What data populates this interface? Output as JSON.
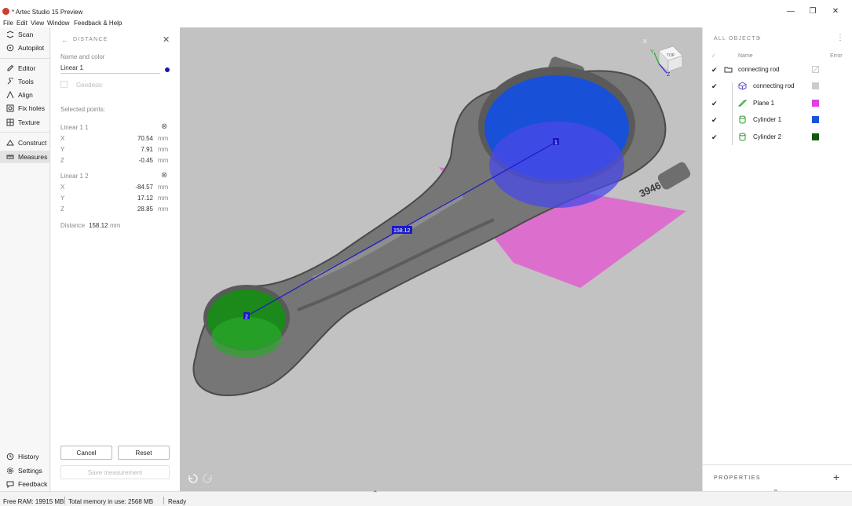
{
  "window": {
    "title": "* Artec Studio 15 Preview",
    "minimize_glyph": "—",
    "restore_glyph": "❐",
    "close_glyph": "✕"
  },
  "menu": [
    "File",
    "Edit",
    "View",
    "Window",
    "Feedback & Help"
  ],
  "sidebar": {
    "items": [
      {
        "label": "Scan",
        "icon": "scan-icon"
      },
      {
        "label": "Autopilot",
        "icon": "autopilot-icon"
      },
      {
        "label": "Editor",
        "icon": "pencil-icon"
      },
      {
        "label": "Tools",
        "icon": "wrench-icon"
      },
      {
        "label": "Align",
        "icon": "align-icon"
      },
      {
        "label": "Fix holes",
        "icon": "fix-holes-icon"
      },
      {
        "label": "Texture",
        "icon": "texture-icon"
      },
      {
        "label": "Construct",
        "icon": "construct-icon"
      },
      {
        "label": "Measures",
        "icon": "ruler-icon"
      }
    ],
    "active_label": "Measures",
    "bottom_items": [
      {
        "label": "History",
        "icon": "history-icon"
      },
      {
        "label": "Settings",
        "icon": "gear-icon"
      },
      {
        "label": "Feedback",
        "icon": "feedback-icon"
      }
    ]
  },
  "panel": {
    "header": "DISTANCE",
    "name_color_label": "Name and color",
    "name_value": "Linear 1",
    "name_color": "#1a1aa8",
    "geodesic_label": "Geodesic",
    "selected_points_label": "Selected points:",
    "points": [
      {
        "title": "Linear 1 1",
        "x": "70.54",
        "y": "7.91",
        "z": "-0.45"
      },
      {
        "title": "Linear 1 2",
        "x": "-84.57",
        "y": "17.12",
        "z": "28.85"
      }
    ],
    "axis_x": "X",
    "axis_y": "Y",
    "axis_z": "Z",
    "unit": "mm",
    "distance_label": "Distance",
    "distance_value": "158.12",
    "cancel_label": "Cancel",
    "reset_label": "Reset",
    "save_label": "Save measurement"
  },
  "viewport": {
    "distance_tag": "158.12",
    "point1_label": "1",
    "point2_label": "2",
    "part_text": "3946",
    "cube_face": "TOP",
    "axis_x": "X",
    "axis_y": "Y",
    "axis_z": "Z",
    "line_color": "#1a1ac8",
    "cylinder1_color": "#1850d8",
    "cylinder2_color": "#1b8a1b",
    "plane_color": "#e060d0"
  },
  "objects": {
    "header": "ALL OBJECTS",
    "col_name": "Name",
    "col_error": "Error",
    "rows": [
      {
        "label": "connecting rod",
        "icon": "folder-icon",
        "color": "none",
        "indent": 0
      },
      {
        "label": "connecting rod",
        "icon": "model-icon",
        "color": "#cccccc",
        "indent": 1
      },
      {
        "label": "Plane 1",
        "icon": "plane-icon",
        "color": "#e040e0",
        "indent": 1
      },
      {
        "label": "Cylinder 1",
        "icon": "cylinder-icon",
        "color": "#1a55d6",
        "indent": 1
      },
      {
        "label": "Cylinder 2",
        "icon": "cylinder-icon",
        "color": "#0f5a0f",
        "indent": 1
      }
    ],
    "properties_label": "PROPERTIES",
    "expand_glyph": "»",
    "add_glyph": "+"
  },
  "status": {
    "free_ram": "Free RAM: 19915 MB",
    "total_memory": "Total memory in use: 2568 MB",
    "state": "Ready"
  }
}
